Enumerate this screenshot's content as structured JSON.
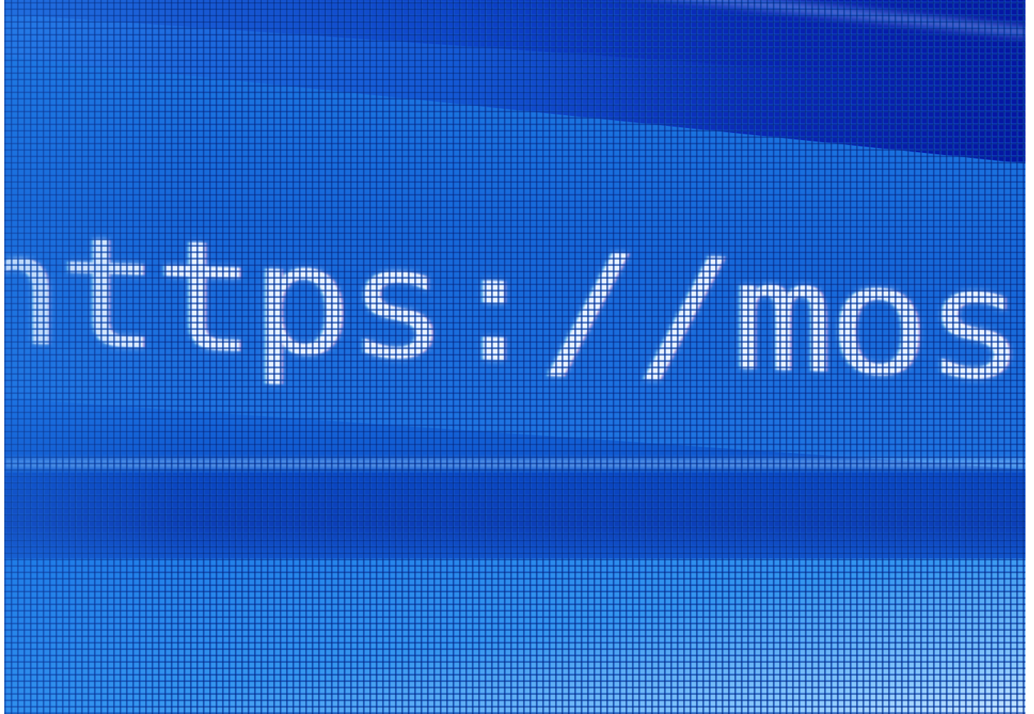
{
  "address_bar": {
    "url_text": "https://mospat.ru"
  },
  "colors": {
    "field_blue": "#1667d8",
    "dark_blue": "#0814a0",
    "light_blue": "#cfe9ff",
    "text_glow": "#e9f3ff"
  }
}
